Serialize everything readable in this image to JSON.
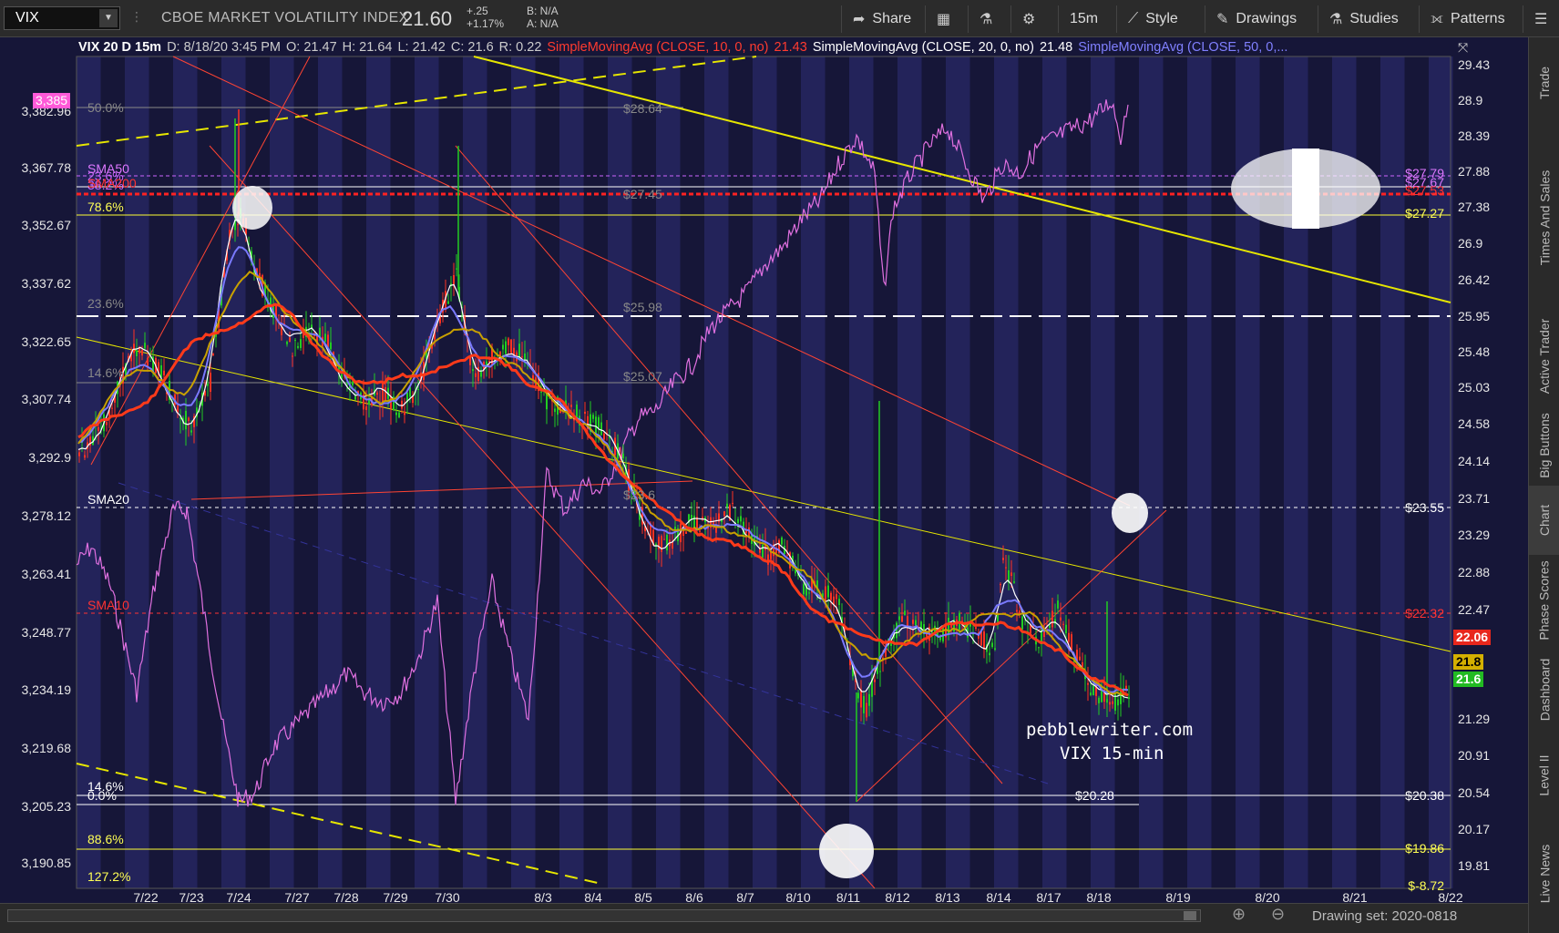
{
  "toolbar": {
    "symbol": "VIX",
    "title": "CBOE MARKET VOLATILITY INDEX",
    "price": "21.60",
    "change_abs": "+.25",
    "change_pct": "+1.17%",
    "bid": "B: N/A",
    "ask": "A: N/A",
    "buttons": {
      "share": "Share",
      "timeframe": "15m",
      "style": "Style",
      "drawings": "Drawings",
      "studies": "Studies",
      "patterns": "Patterns"
    },
    "icons": [
      "share-icon",
      "grid-icon",
      "flask-icon",
      "gear-icon",
      "style-icon",
      "pencil-icon",
      "studies-icon",
      "patterns-icon",
      "menu-icon"
    ]
  },
  "legend": {
    "symbol_info": "VIX 20 D 15m",
    "date": "D: 8/18/20 3:45 PM",
    "open": "O: 21.47",
    "high": "H: 21.64",
    "low": "L: 21.42",
    "close": "C: 21.6",
    "range": "R: 0.22",
    "sma10": "SimpleMovingAvg (CLOSE, 10, 0, no)",
    "sma10_val": "21.43",
    "sma20": "SimpleMovingAvg (CLOSE, 20, 0, no)",
    "sma20_val": "21.48",
    "sma50": "SimpleMovingAvg (CLOSE, 50, 0,...",
    "colors": {
      "sma10": "#ff3b2f",
      "sma20": "#ffffff",
      "sma50": "#8080ff"
    }
  },
  "chart": {
    "type": "candlestick",
    "right_axis": [
      "29.43",
      "28.9",
      "28.39",
      "27.88",
      "27.38",
      "26.9",
      "26.42",
      "25.95",
      "25.48",
      "25.03",
      "24.58",
      "24.14",
      "23.71",
      "23.29",
      "22.88",
      "22.47",
      "22.06",
      "21.8",
      "21.6",
      "21.29",
      "20.91",
      "20.54",
      "20.17",
      "19.81"
    ],
    "left_axis": [
      "3,385",
      "3,382.96",
      "3,367.78",
      "3,352.67",
      "3,337.62",
      "3,322.65",
      "3,307.74",
      "3,292.9",
      "3,278.12",
      "3,263.41",
      "3,248.77",
      "3,234.19",
      "3,219.68",
      "3,205.23",
      "3,190.85"
    ],
    "x_axis": [
      "7/22",
      "7/23",
      "7/24",
      "7/27",
      "7/28",
      "7/29",
      "7/30",
      "8/3",
      "8/4",
      "8/5",
      "8/6",
      "8/7",
      "8/10",
      "8/11",
      "8/12",
      "8/13",
      "8/14",
      "8/17",
      "8/18",
      "8/19",
      "8/20",
      "8/21",
      "8/22"
    ],
    "price_tags": {
      "sma10": "22.06",
      "sma20": "21.8",
      "last": "21.6"
    },
    "fib_left": [
      "50.0%",
      "23.6%",
      "38.2%",
      "78.6%",
      "23.6%",
      "14.6%",
      "14.6%",
      "0.0%",
      "88.6%",
      "127.2%"
    ],
    "sma_labels": [
      "SMA50",
      "SMA200",
      "SMA20",
      "SMA10"
    ],
    "level_labels": [
      "$27.79",
      "$27.67",
      "$27.53",
      "$27.27",
      "$23.55",
      "$22.32",
      "$20.38",
      "$19.86",
      "$-8.72"
    ],
    "mid_labels": [
      "$28.64",
      "$27.45",
      "$25.98",
      "$25.07",
      "$23.6",
      "$20.28"
    ],
    "watermark": [
      "pebblewriter.com",
      "VIX 15-min"
    ]
  },
  "right_tabs": [
    "Trade",
    "Times And Sales",
    "Active Trader",
    "Big Buttons",
    "Chart",
    "Phase Scores",
    "Dashboard",
    "Level II",
    "Live News"
  ],
  "bottom_bar": {
    "drawing_set": "Drawing set: 2020-0818"
  }
}
